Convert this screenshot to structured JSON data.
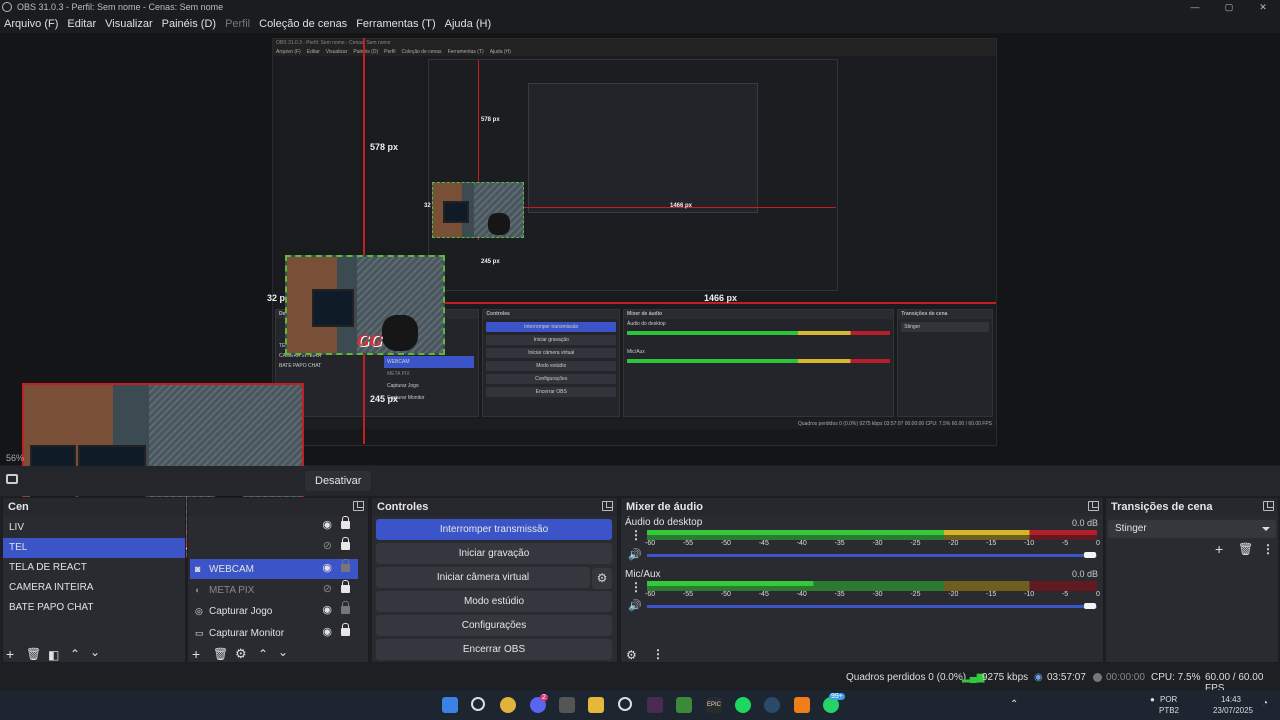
{
  "window": {
    "title": "OBS 31.0.3 - Perfil: Sem nome - Cenas: Sem nome",
    "controls": [
      "—",
      "▢",
      "✕"
    ]
  },
  "menu": {
    "items": [
      "Arquivo (F)",
      "Editar",
      "Visualizar",
      "Painéis (D)",
      "Perfil",
      "Coleção de cenas",
      "Ferramentas (T)",
      "Ajuda (H)"
    ]
  },
  "preview": {
    "nested_title": "OBS 31.0.3 - Perfil: Sem nome - Cenas: Sem nome",
    "nested_menu": [
      "Arquivo (F)",
      "Editar",
      "Visualizar",
      "Painéis (D)",
      "Perfil",
      "Coleção de cenas",
      "Ferramentas (T)",
      "Ajuda (H)"
    ],
    "measure_top": "578 px",
    "measure_left": "32 px",
    "measure_right": "1466 px",
    "measure_bottom": "245 px",
    "measure_inner_top": "578 px",
    "measure_inner_left": "32 px",
    "measure_inner_right": "1466 px",
    "measure_inner_bottom": "245 px",
    "logo_text": "GG",
    "mini_controls": [
      "Interromper transmissão",
      "Iniciar gravação",
      "Iniciar câmera virtual",
      "Modo estúdio",
      "Configurações",
      "Encerrar OBS"
    ],
    "mini_scenes": [
      "TELA DE REACT",
      "CAMERA INTEIRA",
      "BATE PAPO CHAT"
    ],
    "mini_sources": [
      "WEBCAM",
      "META PIX",
      "Capturar Jogo",
      "Capturar Monitor"
    ],
    "mini_heads": {
      "controls": "Controles",
      "mixer": "Mixer de áudio",
      "transitions": "Transições de cena"
    },
    "mini_mixer_tracks": [
      "Áudio do desktop",
      "Mic/Aux"
    ],
    "mini_transition": "Stinger",
    "mini_desativar": "Desativar",
    "mini_status": "Quadros perdidos 0 (0.0%)   9275 kbps   03:57:07   00:00:00   CPU: 7.5%   60.00 / 60.00 FPS",
    "zoom": "56%"
  },
  "strip": {
    "desativar_label": "Desativar"
  },
  "scenes": {
    "header": "Cenas",
    "header_visible": "Cen",
    "items": [
      {
        "label": "LIV"
      },
      {
        "label": "TEL",
        "active": true
      },
      {
        "label": "TELA DE REACT"
      },
      {
        "label": "CAMERA INTEIRA"
      },
      {
        "label": "BATE PAPO CHAT"
      }
    ]
  },
  "sources": {
    "items": [
      {
        "label": "WEBCAM",
        "icon": "camera-icon",
        "active": true
      },
      {
        "label": "META PIX",
        "icon": "image-icon",
        "dim": true
      },
      {
        "label": "Capturar Jogo",
        "icon": "gamepad-icon"
      },
      {
        "label": "Capturar Monitor",
        "icon": "monitor-icon"
      }
    ]
  },
  "controls": {
    "header": "Controles",
    "stop_stream": "Interromper transmissão",
    "start_record": "Iniciar gravação",
    "start_virtualcam": "Iniciar câmera virtual",
    "studio_mode": "Modo estúdio",
    "settings": "Configurações",
    "exit": "Encerrar OBS"
  },
  "mixer": {
    "header": "Mixer de áudio",
    "tracks": [
      {
        "name": "Áudio do desktop",
        "db": "0.0 dB",
        "level": 0.85
      },
      {
        "name": "Mic/Aux",
        "db": "0.0 dB",
        "level": 0.37
      }
    ],
    "ticks": [
      "-60",
      "-55",
      "-50",
      "-45",
      "-40",
      "-35",
      "-30",
      "-25",
      "-20",
      "-15",
      "-10",
      "-5",
      "0"
    ]
  },
  "transitions": {
    "header": "Transições de cena",
    "selected": "Stinger"
  },
  "status": {
    "dropped_frames": "Quadros perdidos 0 (0.0%)",
    "bitrate": "9275 kbps",
    "stream_time": "03:57:07",
    "record_time": "00:00:00",
    "cpu": "CPU: 7.5%",
    "fps": "60.00 / 60.00 FPS"
  },
  "taskbar": {
    "lang_top": "POR",
    "lang_bottom": "PTB2",
    "time": "14:43",
    "date": "23/07/2025",
    "discord_badge": "2",
    "whatsapp_badge": "99+",
    "epic_label": "EPIC"
  },
  "colors": {
    "accent": "#3b55c8",
    "red_guide": "#c31f23",
    "meter_green": "#34c83b",
    "meter_yellow": "#d6b52b",
    "meter_red": "#b51e2b"
  }
}
